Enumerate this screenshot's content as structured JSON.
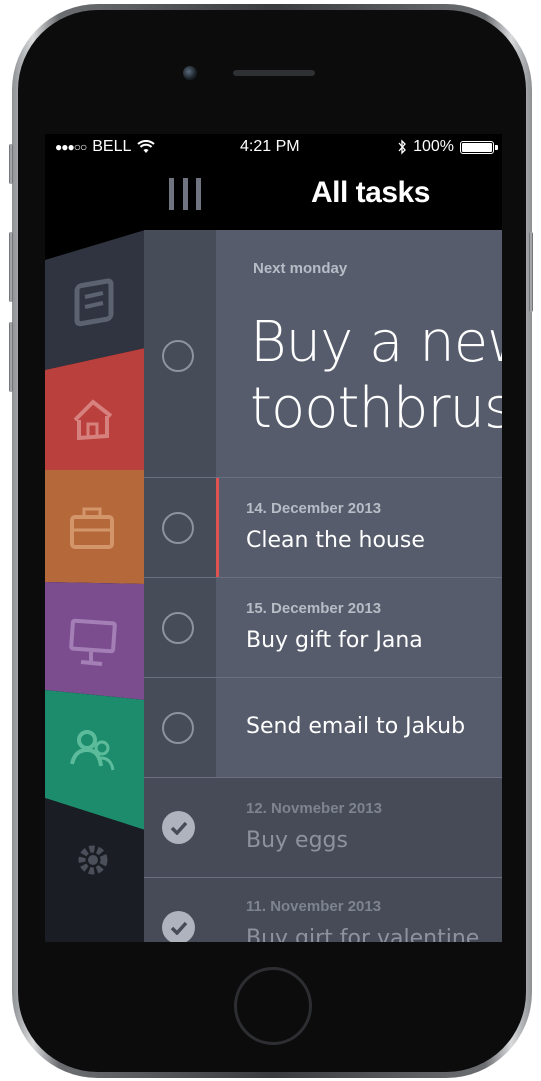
{
  "status_bar": {
    "carrier": "BELL",
    "signal_dots": "●●●○○",
    "time": "4:21 PM",
    "battery": "100%"
  },
  "nav": {
    "title": "All tasks"
  },
  "sidebar": {
    "items": [
      {
        "name": "notes",
        "icon": "note-icon",
        "color": "#2f3440"
      },
      {
        "name": "home",
        "icon": "home-icon",
        "color": "#b9403c"
      },
      {
        "name": "work",
        "icon": "briefcase-icon",
        "color": "#b5693a"
      },
      {
        "name": "computer",
        "icon": "monitor-icon",
        "color": "#7b4d8f"
      },
      {
        "name": "people",
        "icon": "people-icon",
        "color": "#1c8c6c"
      },
      {
        "name": "settings",
        "icon": "gear-icon",
        "color": "#1a1d23"
      }
    ]
  },
  "tasks": [
    {
      "date": "Next monday",
      "title_line1": "Buy a new",
      "title_line2": "toothbrush",
      "done": false,
      "featured": true
    },
    {
      "date": "14. December 2013",
      "title": "Clean the house",
      "done": false,
      "highlight_color": "#e0524f"
    },
    {
      "date": "15. December 2013",
      "title": "Buy gift for Jana",
      "done": false
    },
    {
      "date": "",
      "title": "Send email to Jakub",
      "done": false
    },
    {
      "date": "12. Novmeber 2013",
      "title": "Buy eggs",
      "done": true
    },
    {
      "date": "11. November 2013",
      "title": "Buy girt for valentine",
      "done": true
    }
  ]
}
